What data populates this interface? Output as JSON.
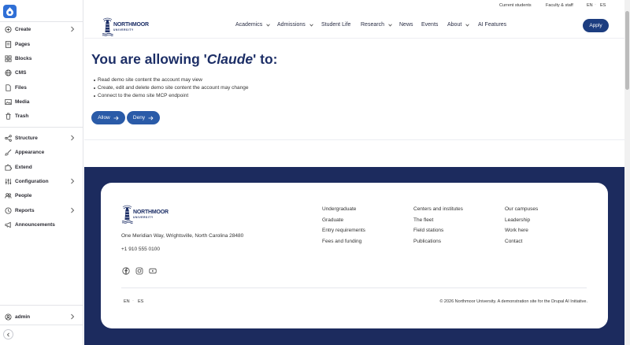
{
  "admin_sidebar": {
    "items": [
      {
        "label": "Create",
        "icon": "plus-circle-icon",
        "has_submenu": true
      },
      {
        "label": "Pages",
        "icon": "page-icon",
        "has_submenu": false
      },
      {
        "label": "Blocks",
        "icon": "blocks-icon",
        "has_submenu": false
      },
      {
        "label": "CMS",
        "icon": "globe-icon",
        "has_submenu": false
      },
      {
        "label": "Files",
        "icon": "file-icon",
        "has_submenu": false
      },
      {
        "label": "Media",
        "icon": "media-icon",
        "has_submenu": false
      },
      {
        "label": "Trash",
        "icon": "trash-icon",
        "has_submenu": false
      },
      {
        "label": "Structure",
        "icon": "structure-icon",
        "has_submenu": true
      },
      {
        "label": "Appearance",
        "icon": "brush-icon",
        "has_submenu": false
      },
      {
        "label": "Extend",
        "icon": "puzzle-icon",
        "has_submenu": false
      },
      {
        "label": "Configuration",
        "icon": "sliders-icon",
        "has_submenu": true
      },
      {
        "label": "People",
        "icon": "people-icon",
        "has_submenu": false
      },
      {
        "label": "Reports",
        "icon": "reports-icon",
        "has_submenu": true
      },
      {
        "label": "Announcements",
        "icon": "megaphone-icon",
        "has_submenu": false
      }
    ],
    "user": {
      "label": "admin",
      "icon": "user-icon"
    }
  },
  "utility_nav": {
    "current_students": "Current students",
    "faculty_staff": "Faculty & staff",
    "lang_en": "EN",
    "lang_es": "ES",
    "sep": "·"
  },
  "site": {
    "brand_name": "NORTHMOOR",
    "brand_sub": "UNIVERSITY",
    "logo_icon": "lighthouse-icon"
  },
  "main_nav": [
    {
      "label": "Academics",
      "dropdown": true
    },
    {
      "label": "Admissions",
      "dropdown": true
    },
    {
      "label": "Student Life",
      "dropdown": false
    },
    {
      "label": "Research",
      "dropdown": true
    },
    {
      "label": "News",
      "dropdown": false
    },
    {
      "label": "Events",
      "dropdown": false
    },
    {
      "label": "About",
      "dropdown": true
    },
    {
      "label": "AI Features",
      "dropdown": false
    }
  ],
  "apply_label": "Apply",
  "consent": {
    "title_prefix": "You are allowing '",
    "client_name": "Claude",
    "title_suffix": "' to:",
    "permissions": [
      "Read demo site content the account may view",
      "Create, edit and delete demo site content the account may change",
      "Connect to the demo site MCP endpoint"
    ],
    "allow_label": "Allow",
    "deny_label": "Deny",
    "button_icon": "arrow-right-icon"
  },
  "footer": {
    "address": "One Meridian Way, Wrightsville, North Carolina 28480",
    "phone": "+1 910 555 0100",
    "social_icons": [
      "facebook-icon",
      "instagram-icon",
      "youtube-icon"
    ],
    "columns": [
      [
        "Undergraduate",
        "Graduate",
        "Entry requirements",
        "Fees and funding"
      ],
      [
        "Centers and institutes",
        "The fleet",
        "Field stations",
        "Publications"
      ],
      [
        "Our campuses",
        "Leadership",
        "Work here",
        "Contact"
      ]
    ],
    "lang_en": "EN",
    "lang_es": "ES",
    "sep": "·",
    "copyright": "© 2026 Northmoor University. A demonstration site for the Drupal AI Initiative."
  },
  "colors": {
    "navy": "#1c2b5e",
    "brand_blue": "#1c3d80",
    "button_blue": "#2a5ba8",
    "drupal_blue": "#2f6fd6"
  }
}
